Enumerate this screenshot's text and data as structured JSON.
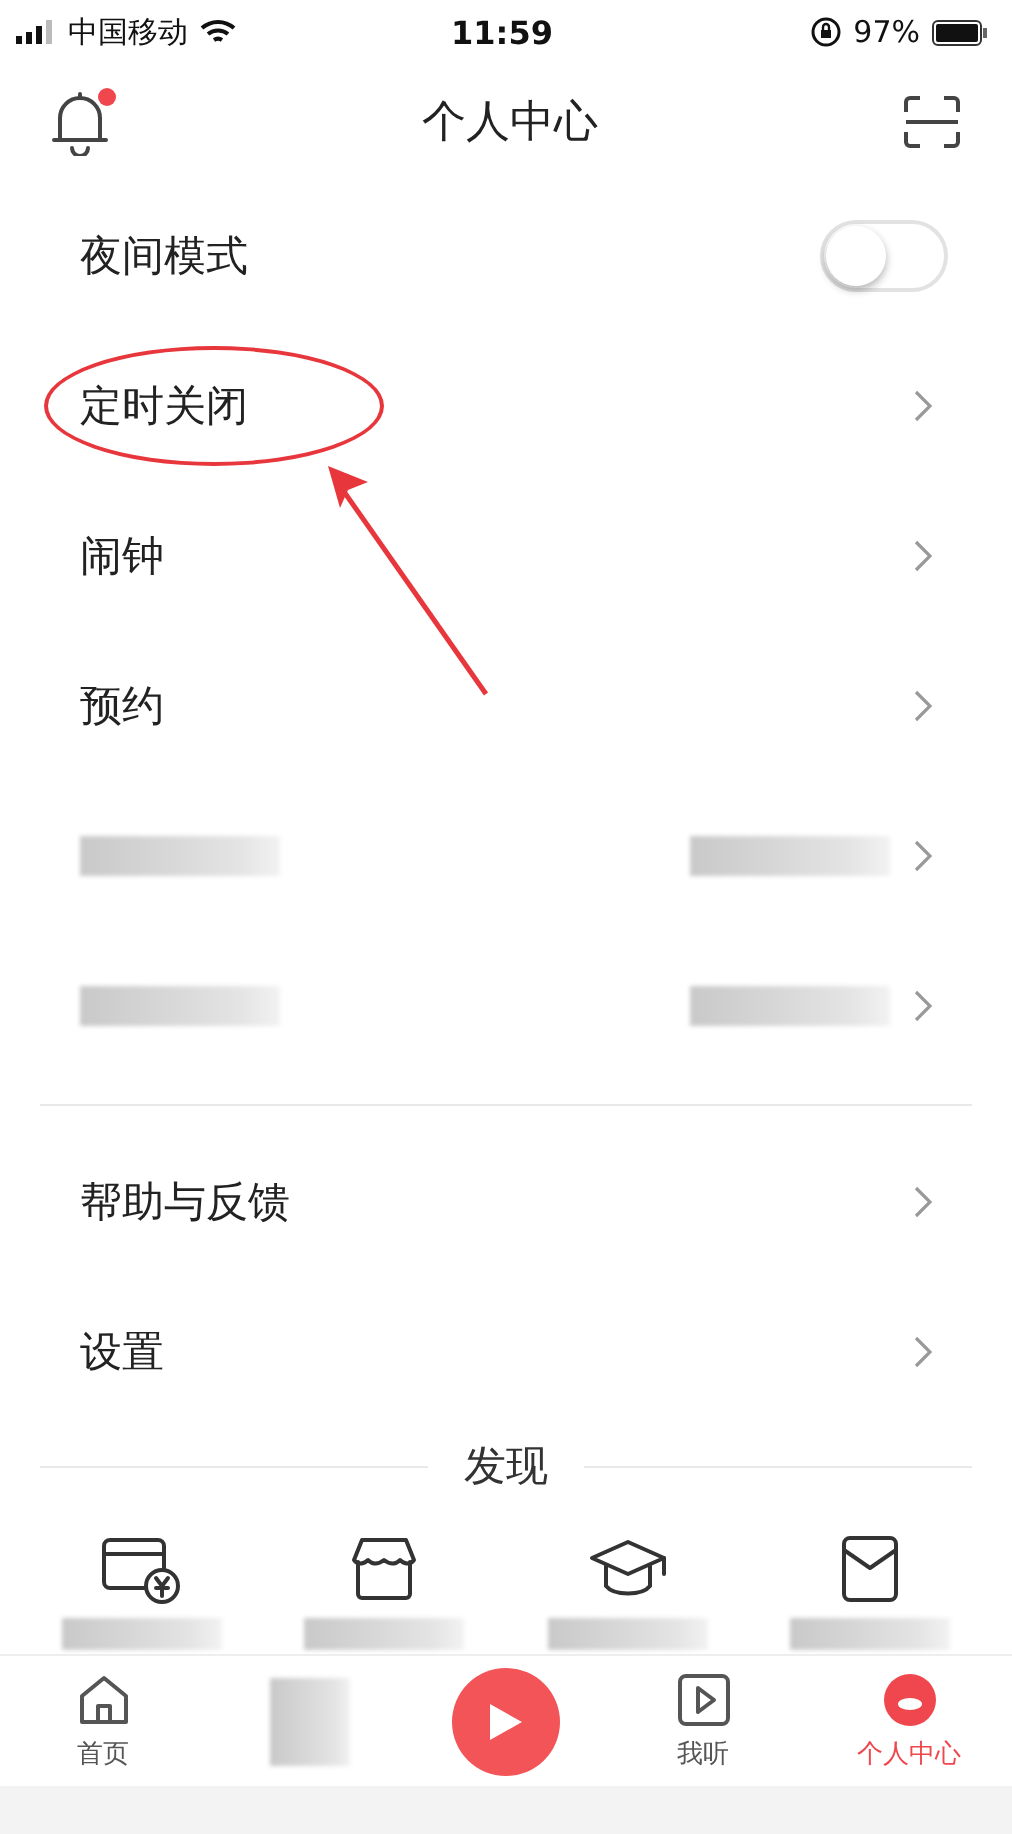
{
  "status_bar": {
    "carrier": "中国移动",
    "time": "11:59",
    "battery": "97%"
  },
  "header": {
    "title": "个人中心",
    "notification_badge": true
  },
  "settings_group": [
    {
      "kind": "toggle",
      "label": "夜间模式",
      "on": false,
      "circled": false
    },
    {
      "kind": "link",
      "label": "定时关闭",
      "circled": true
    },
    {
      "kind": "link",
      "label": "闹钟",
      "circled": false
    },
    {
      "kind": "link",
      "label": "预约",
      "circled": false
    },
    {
      "kind": "redacted",
      "circled": false
    },
    {
      "kind": "redacted",
      "circled": false
    }
  ],
  "help_group": [
    {
      "kind": "link",
      "label": "帮助与反馈",
      "circled": false
    },
    {
      "kind": "link",
      "label": "设置",
      "circled": false
    }
  ],
  "discover": {
    "title": "发现",
    "items": [
      {
        "kind": "card"
      },
      {
        "kind": "store"
      },
      {
        "kind": "cap"
      },
      {
        "kind": "envelope"
      }
    ]
  },
  "tab_bar": [
    {
      "kind": "home",
      "label": "首页",
      "selected": false
    },
    {
      "kind": "redacted",
      "selected": false
    },
    {
      "kind": "play"
    },
    {
      "kind": "listen",
      "label": "我听",
      "selected": false
    },
    {
      "kind": "profile",
      "label": "个人中心",
      "selected": true
    }
  ]
}
